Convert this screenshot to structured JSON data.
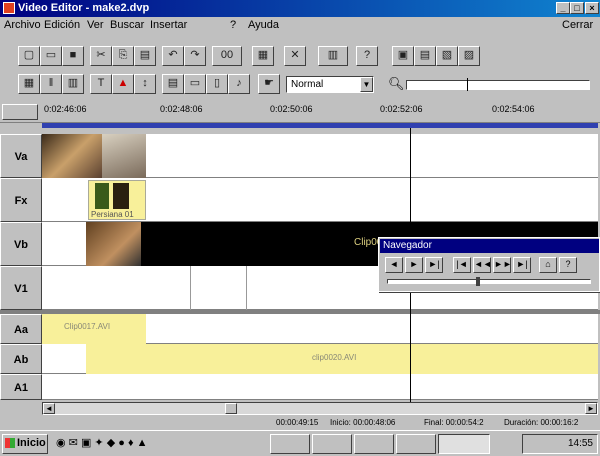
{
  "window": {
    "title": "Video Editor - make2.dvp",
    "minimize": "_",
    "maximize": "□",
    "close": "×"
  },
  "menu": {
    "items": [
      "Archivo",
      "Edición",
      "Ver",
      "Buscar",
      "Insertar",
      "?",
      "Ayuda"
    ],
    "right": "Cerrar"
  },
  "toolbar2": {
    "mode_select": "Normal"
  },
  "ruler": {
    "ticks": [
      "0:02:46:06",
      "0:02:48:06",
      "0:02:50:06",
      "0:02:52:06",
      "0:02:54:06"
    ]
  },
  "tracks": [
    {
      "label": "Va"
    },
    {
      "label": "Fx"
    },
    {
      "label": "Vb"
    },
    {
      "label": "V1"
    },
    {
      "label": "Aa"
    },
    {
      "label": "Ab"
    },
    {
      "label": "A1"
    }
  ],
  "clips": {
    "fx_label": "Persiana 01",
    "vb_label": "Clip0020.AVI",
    "aa_label": "Clip0017.AVI",
    "ab_label": "clip0020.AVI"
  },
  "navigator": {
    "title": "Navegador",
    "buttons": [
      "◄",
      "►",
      "►|",
      "|◄",
      "◄◄",
      "►►",
      "►|",
      "⌂",
      "?"
    ]
  },
  "status": {
    "position": "00:00:49:15",
    "inicio": "Inicio: 00:00:48:06",
    "final": "Final: 00:00:54:2",
    "duracion": "Duración: 00:00:16:2"
  },
  "taskbar": {
    "start": "Inicio",
    "tasks": [
      "",
      "",
      "",
      "",
      "",
      ""
    ],
    "clock": "14:55"
  },
  "colors": {
    "title_start": "#000080",
    "title_end": "#1084d0",
    "track_bar": "#3040b0",
    "clip_yellow": "#f8f09a"
  }
}
